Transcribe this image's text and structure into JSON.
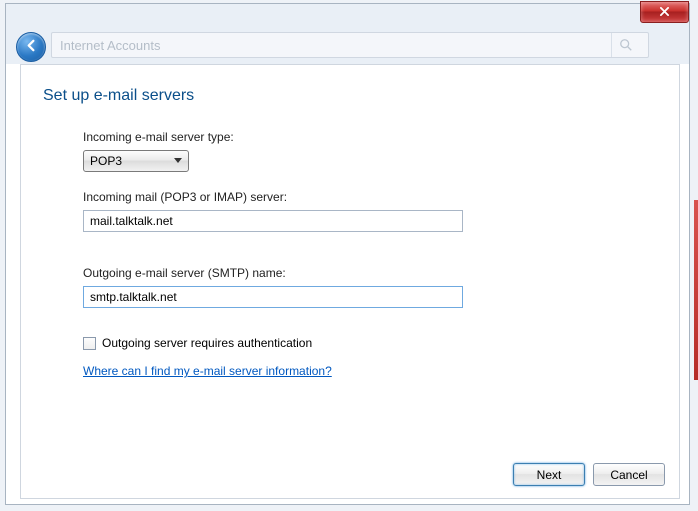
{
  "window": {
    "address_text": "Internet Accounts"
  },
  "dialog": {
    "title": "Set up e-mail servers",
    "incoming_type_label": "Incoming e-mail server type:",
    "incoming_type_value": "POP3",
    "incoming_server_label": "Incoming mail (POP3 or IMAP) server:",
    "incoming_server_value": "mail.talktalk.net",
    "outgoing_server_label": "Outgoing e-mail server (SMTP) name:",
    "outgoing_server_value": "smtp.talktalk.net",
    "auth_checkbox_label": "Outgoing server requires authentication",
    "auth_checkbox_checked": false,
    "help_link": "Where can I find my e-mail server information?",
    "next_label": "Next",
    "cancel_label": "Cancel"
  }
}
